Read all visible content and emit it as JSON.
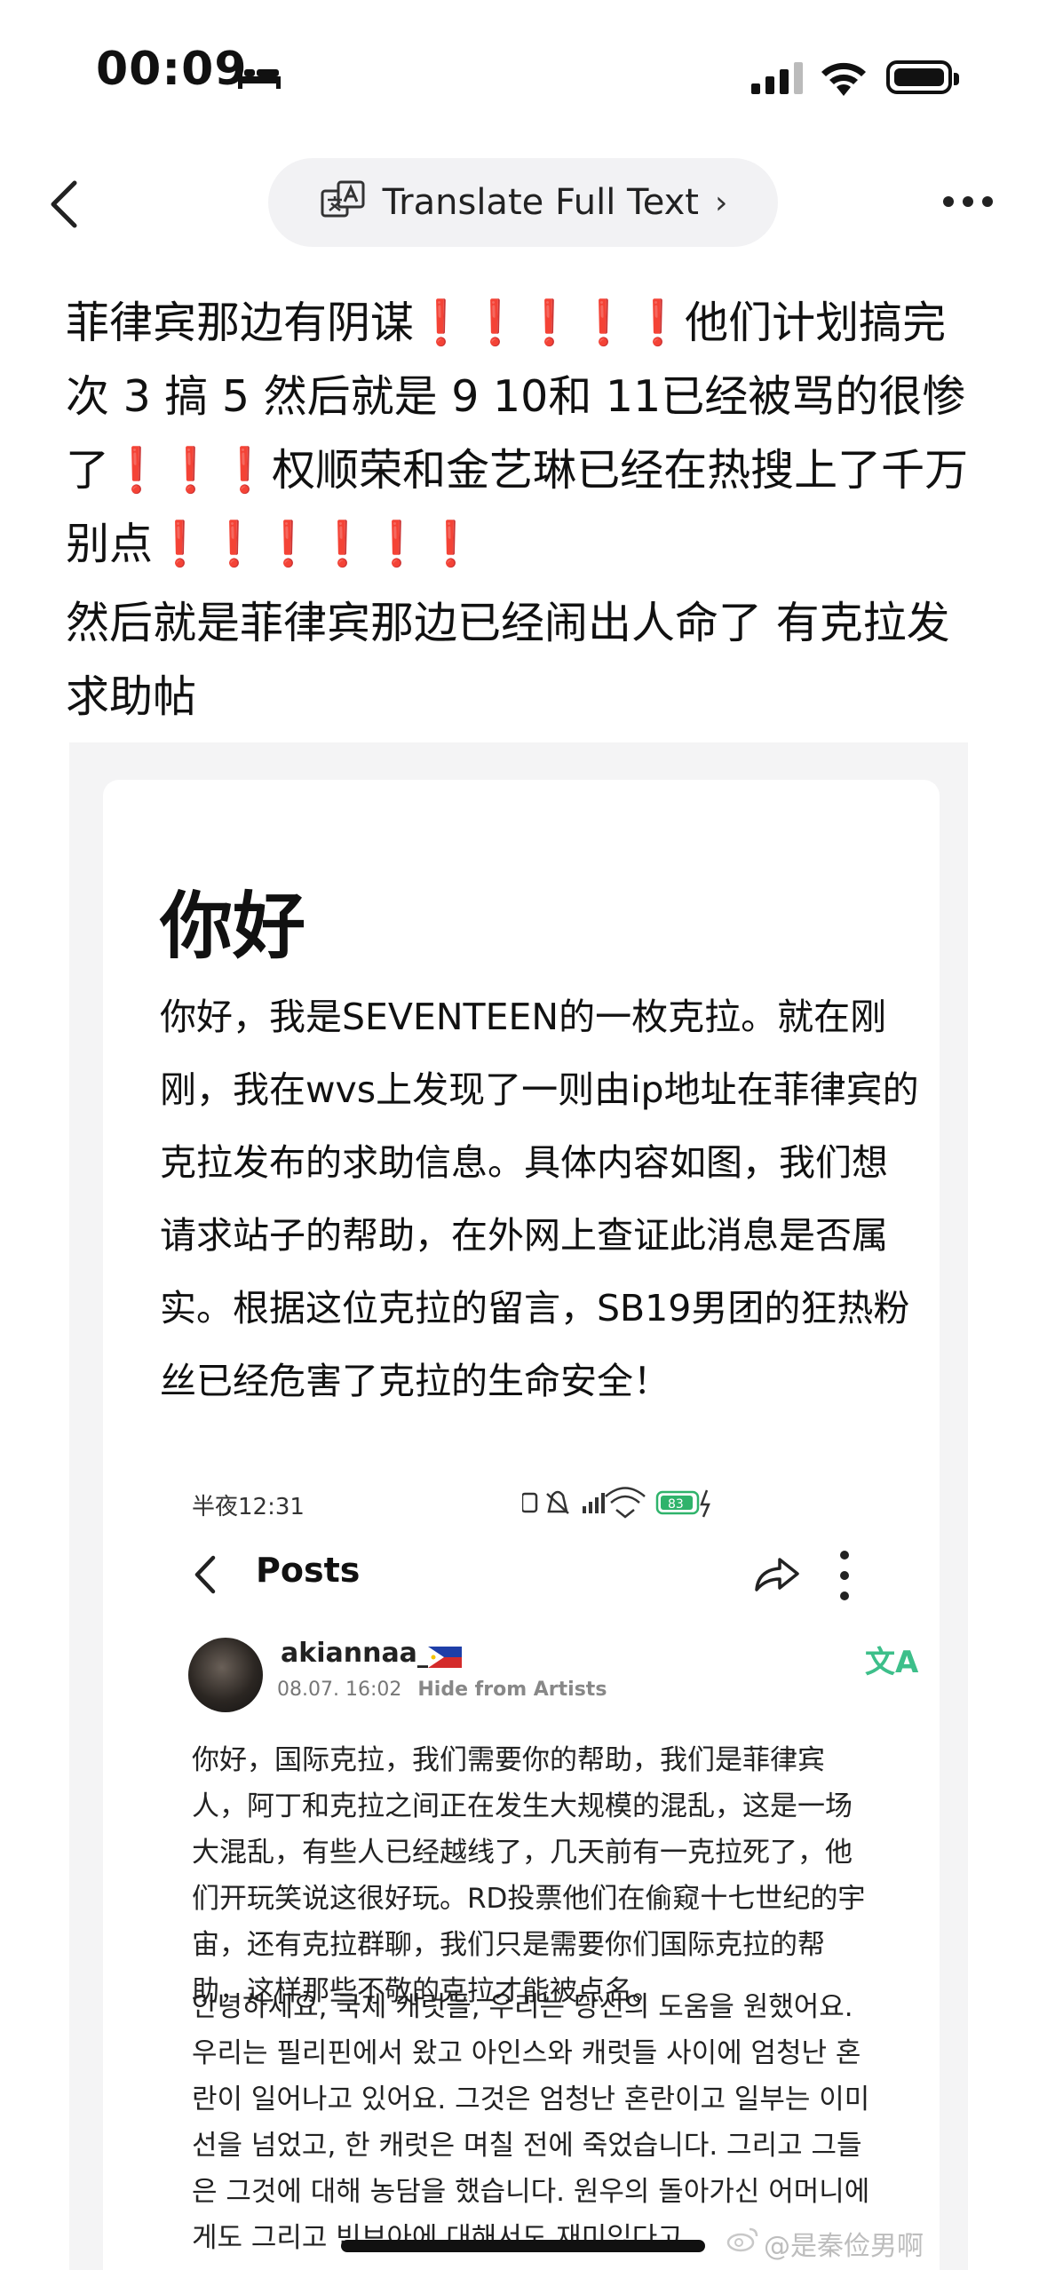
{
  "status_bar": {
    "time": "00:09",
    "sleep_icon": "bed-icon",
    "signal_icon": "cellular-signal-icon",
    "wifi_icon": "wifi-icon",
    "battery_icon": "battery-icon",
    "battery_level": 0.85
  },
  "nav": {
    "back_icon": "chevron-left-icon",
    "translate_label": "Translate Full Text",
    "translate_chevron": "›",
    "translate_icon": "translate-icon",
    "more_icon": "more-dots-icon"
  },
  "post": {
    "line1_a": "菲律宾那边有阴谋",
    "excl_5": "❗❗❗❗❗",
    "line1_b": "他们计划搞完次 3 搞 5 然后就是 9 10和 11已经被骂的很惨了",
    "excl_3": "❗❗❗",
    "line1_c": "权顺荣和金艺琳已经在热搜上了千万别点",
    "excl_6": "❗❗❗❗❗❗",
    "paragraph2": "然后就是菲律宾那边已经闹出人命了 有克拉发求助帖"
  },
  "screenshot": {
    "title": "你好",
    "body": "你好，我是SEVENTEEN的一枚克拉。就在刚刚，我在wvs上发现了一则由ip地址在菲律宾的克拉发布的求助信息。具体内容如图，我们想请求站子的帮助，在外网上查证此消息是否属实。根据这位克拉的留言，SB19男团的狂热粉丝已经危害了克拉的生命安全！",
    "inner_status_time": "半夜12:31",
    "inner_battery": "83",
    "inner_nav_title": "Posts",
    "username": "akiannaa_",
    "date": "08.07. 16:02",
    "hide_label": "Hide from Artists",
    "translate_glyph": "文A",
    "zh_text": "你好，国际克拉，我们需要你的帮助，我们是菲律宾人，阿丁和克拉之间正在发生大规模的混乱，这是一场大混乱，有些人已经越线了，几天前有一克拉死了，他们开玩笑说这很好玩。RD投票他们在偷窥十七世纪的宇宙，还有克拉群聊，我们只是需要你们国际克拉的帮助，这样那些不敬的克拉才能被点名。",
    "ko_text": "안녕하세요, 국제 캐럿들, 우리는 당신의 도움을 원했어요. 우리는 필리핀에서 왔고 아인스와 캐럿들 사이에 엄청난 혼란이 일어나고 있어요. 그것은 엄청난 혼란이고 일부는 이미 선을 넘었고, 한 캐럿은 며칠 전에 죽었습니다. 그리고 그들은 그것에 대해 농담을 했습니다. 원우의 돌아가신 어머니에게도 그리고 빈브아에 대해서도 재미있다고"
  },
  "watermark": "@是秦俭男啊"
}
